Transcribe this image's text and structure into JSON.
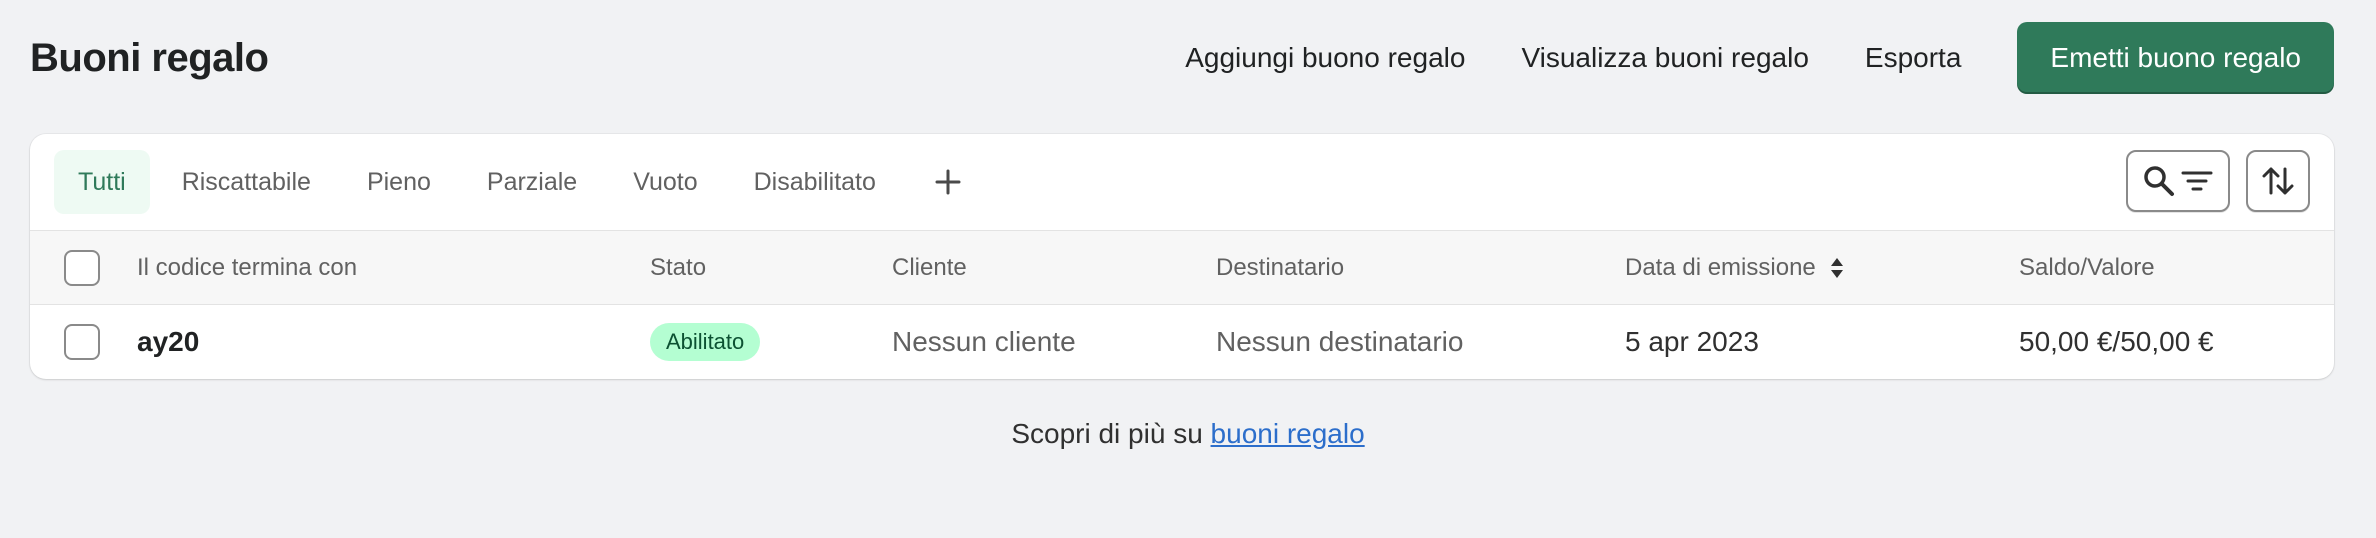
{
  "header": {
    "title": "Buoni regalo",
    "actions": {
      "add": "Aggiungi buono regalo",
      "view": "Visualizza buoni regalo",
      "export": "Esporta"
    },
    "primary_label": "Emetti buono regalo"
  },
  "tabs": [
    {
      "label": "Tutti",
      "active": true
    },
    {
      "label": "Riscattabile",
      "active": false
    },
    {
      "label": "Pieno",
      "active": false
    },
    {
      "label": "Parziale",
      "active": false
    },
    {
      "label": "Vuoto",
      "active": false
    },
    {
      "label": "Disabilitato",
      "active": false
    }
  ],
  "table": {
    "columns": {
      "code": "Il codice termina con",
      "status": "Stato",
      "customer": "Cliente",
      "recipient": "Destinatario",
      "date": "Data di emissione",
      "balance": "Saldo/Valore"
    },
    "rows": [
      {
        "code": "ay20",
        "status": "Abilitato",
        "customer": "Nessun cliente",
        "recipient": "Nessun destinatario",
        "date": "5 apr 2023",
        "balance": "50,00 €/50,00 €"
      }
    ]
  },
  "footer": {
    "text": "Scopri di più su",
    "link": "buoni regalo"
  },
  "colors": {
    "primary": "#2f7a5a",
    "badge_bg": "#b4fed2",
    "link": "#2c6ecb",
    "background": "#f1f2f4"
  }
}
